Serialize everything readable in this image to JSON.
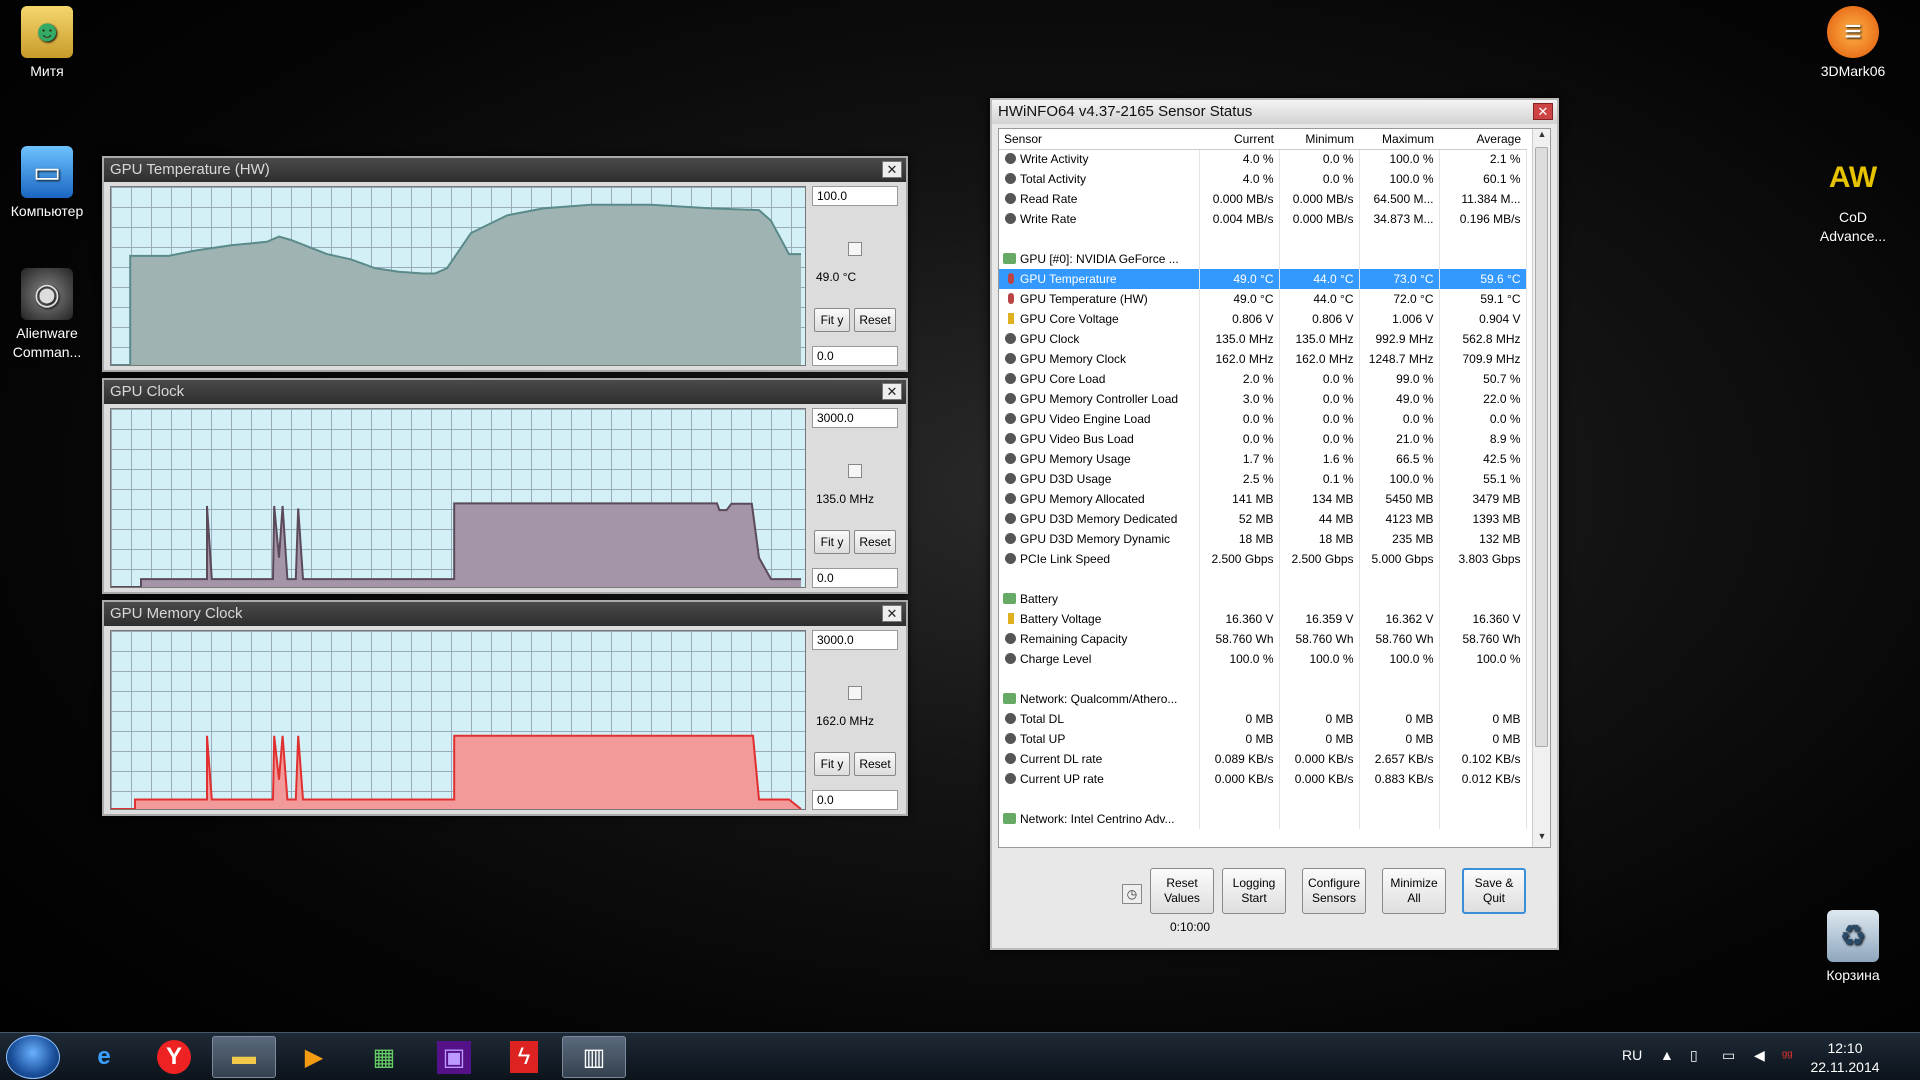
{
  "desktop": {
    "left_icons": [
      {
        "name": "user-folder-icon",
        "label": "Митя"
      },
      {
        "name": "computer-icon",
        "label": "Компьютер"
      },
      {
        "name": "alienware-icon",
        "label": "Alienware Comman..."
      }
    ],
    "right_icons": [
      {
        "name": "3dmark-icon",
        "label": "3DMark06"
      },
      {
        "name": "cod-icon",
        "label": "CoD Advance..."
      },
      {
        "name": "recycle-bin-icon",
        "label": "Корзина"
      }
    ]
  },
  "graphs": [
    {
      "title": "GPU Temperature (HW)",
      "max": "100.0",
      "current": "49.0 °C",
      "min": "0.0",
      "fit_label": "Fit y",
      "reset_label": "Reset",
      "line_color": "#5a8a8a",
      "fill_color": "#9fb3b3",
      "series": [
        [
          0,
          0
        ],
        [
          16,
          0
        ],
        [
          16,
          62
        ],
        [
          48,
          62
        ],
        [
          70,
          65
        ],
        [
          100,
          68
        ],
        [
          130,
          70
        ],
        [
          140,
          73
        ],
        [
          150,
          71
        ],
        [
          180,
          63
        ],
        [
          200,
          60
        ],
        [
          220,
          55
        ],
        [
          240,
          53
        ],
        [
          260,
          52
        ],
        [
          270,
          52
        ],
        [
          280,
          55
        ],
        [
          300,
          75
        ],
        [
          330,
          85
        ],
        [
          360,
          89
        ],
        [
          400,
          91
        ],
        [
          450,
          91
        ],
        [
          500,
          89
        ],
        [
          540,
          88
        ],
        [
          550,
          82
        ],
        [
          565,
          63
        ],
        [
          575,
          63
        ]
      ]
    },
    {
      "title": "GPU Clock",
      "max": "3000.0",
      "current": "135.0 MHz",
      "min": "0.0",
      "fit_label": "Fit y",
      "reset_label": "Reset",
      "line_color": "#5a4a5a",
      "fill_color": "#a496a8",
      "series": [
        [
          0,
          0
        ],
        [
          25,
          0
        ],
        [
          25,
          135
        ],
        [
          80,
          135
        ],
        [
          80,
          1380
        ],
        [
          84,
          135
        ],
        [
          135,
          135
        ],
        [
          136,
          1380
        ],
        [
          140,
          500
        ],
        [
          143,
          1380
        ],
        [
          147,
          135
        ],
        [
          154,
          135
        ],
        [
          156,
          1340
        ],
        [
          160,
          135
        ],
        [
          286,
          135
        ],
        [
          286,
          1425
        ],
        [
          505,
          1425
        ],
        [
          507,
          1310
        ],
        [
          513,
          1310
        ],
        [
          517,
          1420
        ],
        [
          534,
          1420
        ],
        [
          540,
          500
        ],
        [
          550,
          135
        ],
        [
          565,
          135
        ],
        [
          575,
          135
        ]
      ]
    },
    {
      "title": "GPU Memory Clock",
      "max": "3000.0",
      "current": "162.0 MHz",
      "min": "0.0",
      "fit_label": "Fit y",
      "reset_label": "Reset",
      "line_color": "#e03030",
      "fill_color": "#f29a9a",
      "series": [
        [
          0,
          0
        ],
        [
          20,
          0
        ],
        [
          20,
          162
        ],
        [
          80,
          162
        ],
        [
          80,
          1248
        ],
        [
          84,
          162
        ],
        [
          135,
          162
        ],
        [
          136,
          1248
        ],
        [
          140,
          500
        ],
        [
          143,
          1248
        ],
        [
          147,
          162
        ],
        [
          154,
          162
        ],
        [
          156,
          1248
        ],
        [
          160,
          162
        ],
        [
          286,
          162
        ],
        [
          286,
          1248
        ],
        [
          535,
          1248
        ],
        [
          540,
          162
        ],
        [
          565,
          162
        ],
        [
          575,
          0
        ]
      ]
    }
  ],
  "hwinfo": {
    "title": "HWiNFO64 v4.37-2165 Sensor Status",
    "columns": [
      "Sensor",
      "Current",
      "Minimum",
      "Maximum",
      "Average"
    ],
    "rows": [
      {
        "type": "sensor",
        "icon": "dot",
        "cells": [
          "Write Activity",
          "4.0 %",
          "0.0 %",
          "100.0 %",
          "2.1 %"
        ]
      },
      {
        "type": "sensor",
        "icon": "dot",
        "cells": [
          "Total Activity",
          "4.0 %",
          "0.0 %",
          "100.0 %",
          "60.1 %"
        ]
      },
      {
        "type": "sensor",
        "icon": "dot",
        "cells": [
          "Read Rate",
          "0.000 MB/s",
          "0.000 MB/s",
          "64.500 M...",
          "11.384 M..."
        ]
      },
      {
        "type": "sensor",
        "icon": "dot",
        "cells": [
          "Write Rate",
          "0.004 MB/s",
          "0.000 MB/s",
          "34.873 M...",
          "0.196 MB/s"
        ]
      },
      {
        "type": "blank",
        "icon": "",
        "cells": [
          "",
          "",
          "",
          "",
          ""
        ]
      },
      {
        "type": "group",
        "icon": "grp",
        "cells": [
          "GPU [#0]: NVIDIA GeForce ...",
          "",
          "",
          "",
          ""
        ]
      },
      {
        "type": "selected",
        "icon": "temp",
        "cells": [
          "GPU Temperature",
          "49.0 °C",
          "44.0 °C",
          "73.0 °C",
          "59.6 °C"
        ]
      },
      {
        "type": "sensor",
        "icon": "temp",
        "cells": [
          "GPU Temperature (HW)",
          "49.0 °C",
          "44.0 °C",
          "72.0 °C",
          "59.1 °C"
        ]
      },
      {
        "type": "sensor",
        "icon": "volt",
        "cells": [
          "GPU Core Voltage",
          "0.806 V",
          "0.806 V",
          "1.006 V",
          "0.904 V"
        ]
      },
      {
        "type": "sensor",
        "icon": "dot",
        "cells": [
          "GPU Clock",
          "135.0 MHz",
          "135.0 MHz",
          "992.9 MHz",
          "562.8 MHz"
        ]
      },
      {
        "type": "sensor",
        "icon": "dot",
        "cells": [
          "GPU Memory Clock",
          "162.0 MHz",
          "162.0 MHz",
          "1248.7 MHz",
          "709.9 MHz"
        ]
      },
      {
        "type": "sensor",
        "icon": "dot",
        "cells": [
          "GPU Core Load",
          "2.0 %",
          "0.0 %",
          "99.0 %",
          "50.7 %"
        ]
      },
      {
        "type": "sensor",
        "icon": "dot",
        "cells": [
          "GPU Memory Controller Load",
          "3.0 %",
          "0.0 %",
          "49.0 %",
          "22.0 %"
        ]
      },
      {
        "type": "sensor",
        "icon": "dot",
        "cells": [
          "GPU Video Engine Load",
          "0.0 %",
          "0.0 %",
          "0.0 %",
          "0.0 %"
        ]
      },
      {
        "type": "sensor",
        "icon": "dot",
        "cells": [
          "GPU Video Bus Load",
          "0.0 %",
          "0.0 %",
          "21.0 %",
          "8.9 %"
        ]
      },
      {
        "type": "sensor",
        "icon": "dot",
        "cells": [
          "GPU Memory Usage",
          "1.7 %",
          "1.6 %",
          "66.5 %",
          "42.5 %"
        ]
      },
      {
        "type": "sensor",
        "icon": "dot",
        "cells": [
          "GPU D3D Usage",
          "2.5 %",
          "0.1 %",
          "100.0 %",
          "55.1 %"
        ]
      },
      {
        "type": "sensor",
        "icon": "dot",
        "cells": [
          "GPU Memory Allocated",
          "141 MB",
          "134 MB",
          "5450 MB",
          "3479 MB"
        ]
      },
      {
        "type": "sensor",
        "icon": "dot",
        "cells": [
          "GPU D3D Memory Dedicated",
          "52 MB",
          "44 MB",
          "4123 MB",
          "1393 MB"
        ]
      },
      {
        "type": "sensor",
        "icon": "dot",
        "cells": [
          "GPU D3D Memory Dynamic",
          "18 MB",
          "18 MB",
          "235 MB",
          "132 MB"
        ]
      },
      {
        "type": "sensor",
        "icon": "dot",
        "cells": [
          "PCIe Link Speed",
          "2.500 Gbps",
          "2.500 Gbps",
          "5.000 Gbps",
          "3.803 Gbps"
        ]
      },
      {
        "type": "blank",
        "icon": "",
        "cells": [
          "",
          "",
          "",
          "",
          ""
        ]
      },
      {
        "type": "group",
        "icon": "grp",
        "cells": [
          "Battery",
          "",
          "",
          "",
          ""
        ]
      },
      {
        "type": "sensor",
        "icon": "volt",
        "cells": [
          "Battery Voltage",
          "16.360 V",
          "16.359 V",
          "16.362 V",
          "16.360 V"
        ]
      },
      {
        "type": "sensor",
        "icon": "dot",
        "cells": [
          "Remaining Capacity",
          "58.760 Wh",
          "58.760 Wh",
          "58.760 Wh",
          "58.760 Wh"
        ]
      },
      {
        "type": "sensor",
        "icon": "dot",
        "cells": [
          "Charge Level",
          "100.0 %",
          "100.0 %",
          "100.0 %",
          "100.0 %"
        ]
      },
      {
        "type": "blank",
        "icon": "",
        "cells": [
          "",
          "",
          "",
          "",
          ""
        ]
      },
      {
        "type": "group",
        "icon": "grp",
        "cells": [
          "Network: Qualcomm/Athero...",
          "",
          "",
          "",
          ""
        ]
      },
      {
        "type": "sensor",
        "icon": "dot",
        "cells": [
          "Total DL",
          "0 MB",
          "0 MB",
          "0 MB",
          "0 MB"
        ]
      },
      {
        "type": "sensor",
        "icon": "dot",
        "cells": [
          "Total UP",
          "0 MB",
          "0 MB",
          "0 MB",
          "0 MB"
        ]
      },
      {
        "type": "sensor",
        "icon": "dot",
        "cells": [
          "Current DL rate",
          "0.089 KB/s",
          "0.000 KB/s",
          "2.657 KB/s",
          "0.102 KB/s"
        ]
      },
      {
        "type": "sensor",
        "icon": "dot",
        "cells": [
          "Current UP rate",
          "0.000 KB/s",
          "0.000 KB/s",
          "0.883 KB/s",
          "0.012 KB/s"
        ]
      },
      {
        "type": "blank",
        "icon": "",
        "cells": [
          "",
          "",
          "",
          "",
          ""
        ]
      },
      {
        "type": "group",
        "icon": "grp",
        "cells": [
          "Network: Intel Centrino Adv...",
          "",
          "",
          "",
          ""
        ]
      }
    ],
    "buttons": {
      "reset_values": "Reset Values",
      "logging_start": "Logging Start",
      "configure_sensors": "Configure Sensors",
      "minimize_all": "Minimize All",
      "save_quit": "Save & Quit"
    },
    "timer": "0:10:00"
  },
  "taskbar": {
    "apps": [
      "internet-explorer-icon",
      "yandex-browser-icon",
      "file-explorer-icon",
      "media-player-icon",
      "image-viewer-icon",
      "cpu-tool-icon",
      "flash-tool-icon",
      "hwinfo-icon"
    ],
    "language": "RU",
    "time": "12:10",
    "date": "22.11.2014"
  }
}
